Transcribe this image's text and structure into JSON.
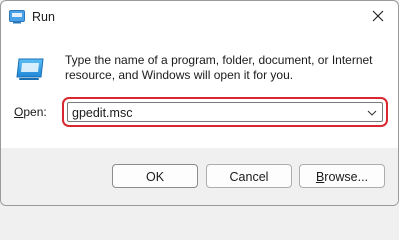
{
  "window": {
    "title": "Run",
    "close_glyph": "✕",
    "icons": {
      "app": "run-icon",
      "dialog": "run-dialog-icon",
      "close": "close-icon",
      "dropdown": "chevron-down-icon"
    },
    "colors": {
      "accent": "#0067c0",
      "highlight_border": "#d9282f"
    }
  },
  "content": {
    "description_line1": "Type the name of a program, folder, document, or Internet",
    "description_line2": "resource, and Windows will open it for you.",
    "open_label_accel": "O",
    "open_label_rest": "pen:",
    "open_value": "gpedit.msc"
  },
  "buttons": {
    "ok": "OK",
    "cancel": "Cancel",
    "browse_accel": "B",
    "browse_rest": "rowse..."
  }
}
